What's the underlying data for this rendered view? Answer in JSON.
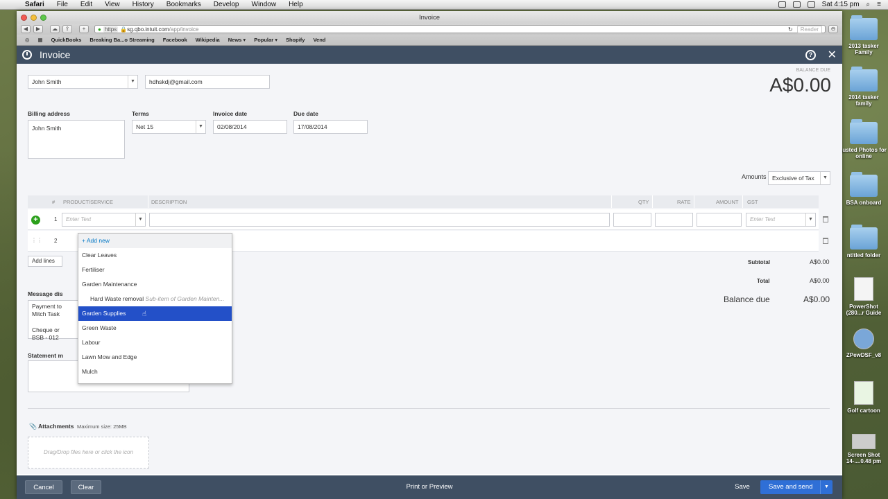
{
  "menubar": {
    "app": "Safari",
    "items": [
      "File",
      "Edit",
      "View",
      "History",
      "Bookmarks",
      "Develop",
      "Window",
      "Help"
    ],
    "clock": "Sat 4:15 pm"
  },
  "browser": {
    "window_title": "Invoice",
    "url_scheme": "https",
    "url_host": "sg.qbo.intuit.com",
    "url_path": "/app/invoice",
    "reader_label": "Reader",
    "bookmarks": [
      "QuickBooks",
      "Breaking Ba...o Streaming",
      "Facebook",
      "Wikipedia",
      "News ▾",
      "Popular ▾",
      "Shopify",
      "Vend"
    ]
  },
  "header": {
    "title": "Invoice",
    "help_glyph": "?",
    "close_glyph": "✕"
  },
  "customer": {
    "name": "John Smith",
    "email": "hdhskdj@gmail.com"
  },
  "balance": {
    "label": "BALANCE DUE",
    "amount": "A$0.00"
  },
  "billing": {
    "label": "Billing address",
    "value": "John Smith"
  },
  "terms": {
    "label": "Terms",
    "value": "Net 15"
  },
  "invoice_date": {
    "label": "Invoice date",
    "value": "02/08/2014"
  },
  "due_date": {
    "label": "Due date",
    "value": "17/08/2014"
  },
  "amounts_are": {
    "label": "Amounts are",
    "value": "Exclusive of Tax"
  },
  "table": {
    "columns": [
      "#",
      "PRODUCT/SERVICE",
      "DESCRIPTION",
      "QTY",
      "RATE",
      "AMOUNT",
      "GST"
    ],
    "rows": [
      {
        "num": "1",
        "product_placeholder": "Enter Text",
        "gst_placeholder": "Enter Text"
      },
      {
        "num": "2"
      }
    ],
    "add_lines": "Add lines"
  },
  "dropdown": {
    "add_new": "+ Add new",
    "items": [
      "Clear Leaves",
      "Fertiliser",
      "Garden Maintenance",
      "Hard Waste removal",
      "Garden Supplies",
      "Green Waste",
      "Labour",
      "Lawn Mow and Edge",
      "Mulch"
    ],
    "sub_note": "Sub-item of Garden Mainten...",
    "selected": "Garden Supplies"
  },
  "totals": {
    "subtotal_label": "Subtotal",
    "subtotal": "A$0.00",
    "total_label": "Total",
    "total": "A$0.00",
    "balance_due_label": "Balance due",
    "balance_due": "A$0.00"
  },
  "message": {
    "label": "Message dis",
    "lines": [
      "Payment to",
      "Mitch Task",
      "Cheque or",
      "BSB - 012"
    ]
  },
  "statement": {
    "label": "Statement m"
  },
  "attachments": {
    "label": "Attachments",
    "max": "Maximum size: 25MB",
    "drop_hint": "Drag/Drop files here or click the icon"
  },
  "footer": {
    "cancel": "Cancel",
    "clear": "Clear",
    "print": "Print or Preview",
    "save": "Save",
    "save_send": "Save and send"
  },
  "desktop_icons": [
    "2013 tasker Family",
    "2014 tasker family",
    "justed Photos for online",
    "BSA onboard",
    "ntitled folder",
    "PowerShot (280...r Guide",
    "ZPewDSF_v8",
    "Golf cartoon",
    "Screen Shot 14-....0.48 pm"
  ]
}
